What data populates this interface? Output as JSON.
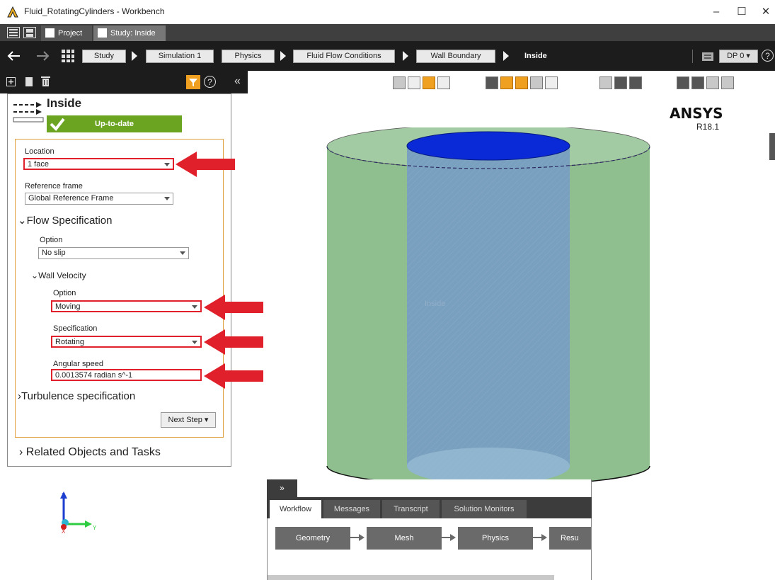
{
  "window": {
    "title": "Fluid_RotatingCylinders - Workbench",
    "minimize": "–",
    "maximize": "☐",
    "close": "✕"
  },
  "tabs": [
    {
      "label": "Project"
    },
    {
      "label": "Study: Inside"
    }
  ],
  "breadcrumb": {
    "items": [
      "Study",
      "Simulation 1",
      "Physics",
      "Fluid Flow Conditions",
      "Wall Boundary"
    ],
    "current": "Inside",
    "design_point": "DP 0 ▾",
    "help": "?"
  },
  "panel": {
    "title": "Inside",
    "status": "Up-to-date",
    "location_label": "Location",
    "location_value": "1 face",
    "ref_frame_label": "Reference frame",
    "ref_frame_value": "Global Reference Frame",
    "flow_spec_title": "Flow Specification",
    "option_label": "Option",
    "option_value": "No slip",
    "wall_velocity_title": "Wall Velocity",
    "wv_option_label": "Option",
    "wv_option_value": "Moving",
    "spec_label": "Specification",
    "spec_value": "Rotating",
    "angular_label": "Angular speed",
    "angular_value": "0.0013574 radian s^-1",
    "turbulence_title": "Turbulence specification",
    "next_step": "Next Step ▾",
    "related_title": "Related Objects and Tasks"
  },
  "toolbar": {
    "collapse": "«",
    "help": "?"
  },
  "viewport": {
    "brand": "ANSYS",
    "version": "R18.1",
    "inner_label": "Inside",
    "axis_z": "Z",
    "axis_y": "Y",
    "axis_x": "X",
    "colors": {
      "outer_cylinder": "#8fbf8f",
      "inner_cylinder": "#7aa0c0",
      "inner_top": "#0a2ad8"
    }
  },
  "bottom": {
    "collapse": "»",
    "tabs": [
      "Workflow",
      "Messages",
      "Transcript",
      "Solution Monitors"
    ],
    "workflow": [
      "Geometry",
      "Mesh",
      "Physics",
      "Resu"
    ]
  },
  "accent": {
    "highlight": "#e0202a",
    "status_green": "#6aa421",
    "orange": "#f0a020"
  }
}
